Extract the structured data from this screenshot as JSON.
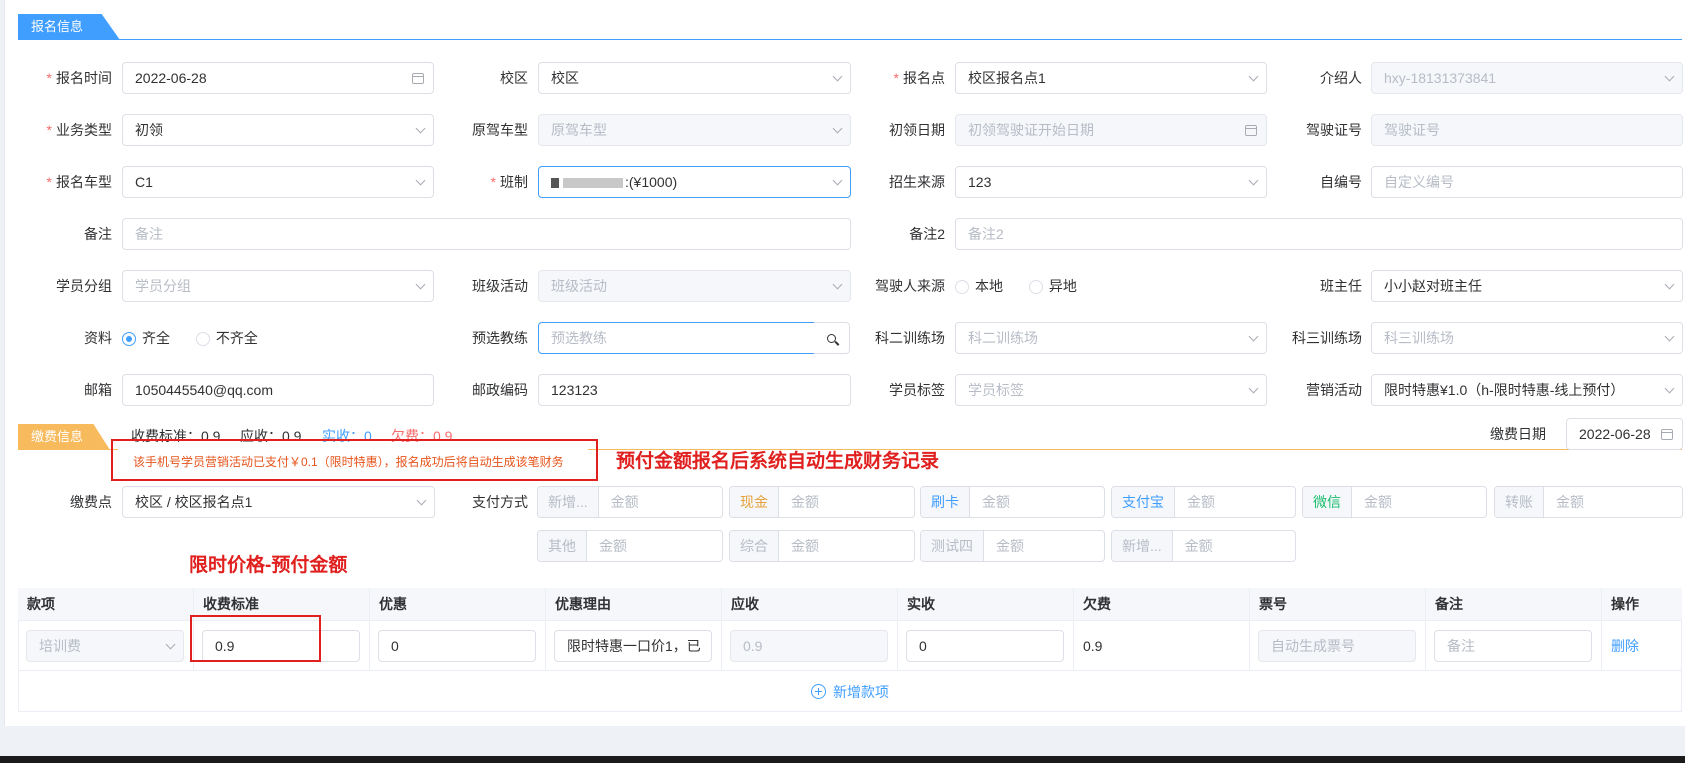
{
  "colors": {
    "primary": "#409eff",
    "warning": "#f7ba5c",
    "annotation_red": "#e0201f",
    "wechat_green": "#19be6b",
    "cash_gold": "#e6a23c"
  },
  "section_registration": {
    "title": "报名信息"
  },
  "section_payment": {
    "title": "缴费信息"
  },
  "form": {
    "reg_time": {
      "label": "报名时间",
      "value": "2022-06-28"
    },
    "campus": {
      "label": "校区",
      "value": "校区"
    },
    "reg_point": {
      "label": "报名点",
      "value": "校区报名点1"
    },
    "referrer": {
      "label": "介绍人",
      "value": "hxy-18131373841"
    },
    "business_type": {
      "label": "业务类型",
      "value": "初领"
    },
    "orig_vehicle": {
      "label": "原驾车型",
      "placeholder": "原驾车型"
    },
    "first_date": {
      "label": "初领日期",
      "placeholder": "初领驾驶证开始日期"
    },
    "license_no": {
      "label": "驾驶证号",
      "placeholder": "驾驶证号"
    },
    "vehicle_type": {
      "label": "报名车型",
      "value": "C1"
    },
    "class": {
      "label": "班制",
      "value": ":(¥1000)"
    },
    "source": {
      "label": "招生来源",
      "value": "123"
    },
    "custom_no": {
      "label": "自编号",
      "placeholder": "自定义编号"
    },
    "remark": {
      "label": "备注",
      "placeholder": "备注"
    },
    "remark2": {
      "label": "备注2",
      "placeholder": "备注2"
    },
    "student_group": {
      "label": "学员分组",
      "placeholder": "学员分组"
    },
    "class_activity": {
      "label": "班级活动",
      "placeholder": "班级活动"
    },
    "driver_source": {
      "label": "驾驶人来源",
      "options": [
        "本地",
        "异地"
      ]
    },
    "head_teacher": {
      "label": "班主任",
      "value": "小小赵对班主任"
    },
    "materials": {
      "label": "资料",
      "options": [
        "齐全",
        "不齐全"
      ]
    },
    "coach": {
      "label": "预选教练",
      "placeholder": "预选教练"
    },
    "subject2": {
      "label": "科二训练场",
      "placeholder": "科二训练场"
    },
    "subject3": {
      "label": "科三训练场",
      "placeholder": "科三训练场"
    },
    "email": {
      "label": "邮箱",
      "value": "1050445540@qq.com"
    },
    "postcode": {
      "label": "邮政编码",
      "value": "123123"
    },
    "student_tag": {
      "label": "学员标签",
      "placeholder": "学员标签"
    },
    "marketing": {
      "label": "营销活动",
      "value": "限时特惠¥1.0（h-限时特惠-线上预付）"
    }
  },
  "payment": {
    "summary": [
      {
        "label": "收费标准：",
        "value": "0.9"
      },
      {
        "label": "应收：",
        "value": "0.9"
      },
      {
        "label": "实收：",
        "value": "0"
      },
      {
        "label": "欠费：",
        "value": "0.9"
      }
    ],
    "notice": "该手机号学员营销活动已支付￥0.1（限时特惠），报名成功后将自动生成该笔财务",
    "pay_date": {
      "label": "缴费日期",
      "value": "2022-06-28"
    },
    "pay_point": {
      "label": "缴费点",
      "value": "校区 / 校区报名点1"
    },
    "method_label": "支付方式",
    "amount_placeholder": "金额",
    "methods": [
      "新增...",
      "现金",
      "刷卡",
      "支付宝",
      "微信",
      "转账",
      "其他",
      "综合",
      "测试四",
      "新增..."
    ]
  },
  "annotations": {
    "prepay_note": "预付金额报名后系统自动生成财务记录",
    "price_note": "限时价格-预付金额"
  },
  "fee_table": {
    "headers": [
      "款项",
      "收费标准",
      "优惠",
      "优惠理由",
      "应收",
      "实收",
      "欠费",
      "票号",
      "备注",
      "操作"
    ],
    "row": {
      "item": "培训费",
      "standard": "0.9",
      "discount": "0",
      "reason": "限时特惠一口价1，已",
      "receivable": "0.9",
      "received": "0",
      "arrears": "0.9",
      "ticket_placeholder": "自动生成票号",
      "remark_placeholder": "备注",
      "delete": "删除"
    },
    "add_label": "新增款项"
  }
}
